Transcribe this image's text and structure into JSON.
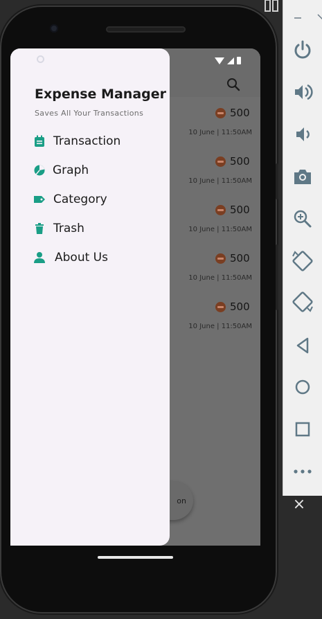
{
  "drawer": {
    "title": "Expense Manager",
    "subtitle": "Saves All Your Transactions",
    "menu": [
      {
        "label": "Transaction",
        "icon": "calendar-icon"
      },
      {
        "label": "Graph",
        "icon": "pie-chart-icon"
      },
      {
        "label": "Category",
        "icon": "label-icon"
      },
      {
        "label": "Trash",
        "icon": "trash-icon"
      },
      {
        "label": "About Us",
        "icon": "person-icon"
      }
    ]
  },
  "transactions": [
    {
      "amount": "500",
      "date": "10 June | 11:50AM"
    },
    {
      "amount": "500",
      "date": "10 June | 11:50AM"
    },
    {
      "amount": "500",
      "date": "10 June | 11:50AM"
    },
    {
      "amount": "500",
      "date": "10 June | 11:50AM"
    },
    {
      "amount": "500",
      "date": "10 June | 11:50AM"
    }
  ],
  "fab": {
    "label": "on"
  },
  "colors": {
    "accent": "#1a9e86",
    "drawer_bg": "#f6f2f8",
    "scrim": "#6f6f6f",
    "expense_badge": "#7a3e22"
  },
  "emulator": {
    "close": "×"
  }
}
